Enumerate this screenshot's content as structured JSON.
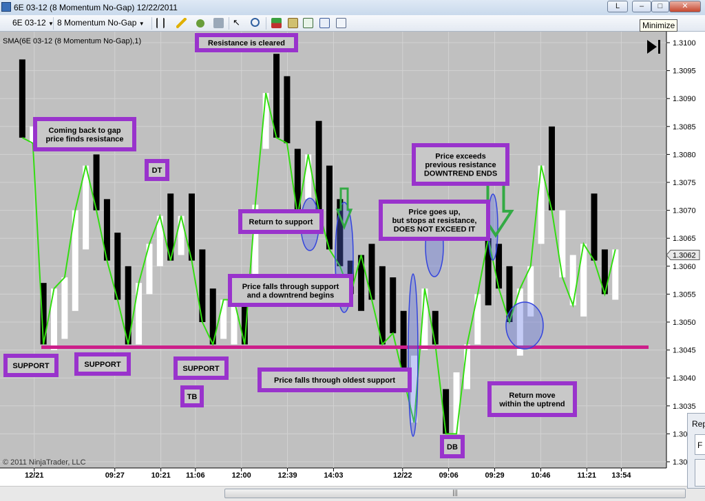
{
  "window": {
    "title": "6E 03-12 (8 Momentum No-Gap)  12/22/2011",
    "buttons": {
      "layout": "L",
      "minimize": "–",
      "restore": "□",
      "close": "✕"
    }
  },
  "toolbar": {
    "instrument": "6E 03-12",
    "period": "8 Momentum No-Gap",
    "tooltip": "Minimize",
    "icons": [
      "bar-style-icon",
      "draw-pencil-icon",
      "add-indicator-icon",
      "strategy-icon",
      "pointer-icon",
      "zoom-icon",
      "orders-icon",
      "trade-data-icon",
      "chart-data-icon",
      "properties-icon"
    ]
  },
  "chart_data": {
    "type": "bar",
    "indicator_label": "SMA(6E 03-12 (8 Momentum No-Gap),1)",
    "copyright": "© 2011 NinjaTrader, LLC",
    "price_marker": "1.3062",
    "ylim": [
      1.3025,
      1.3103
    ],
    "y_ticks": [
      "1.3100",
      "1.3095",
      "1.3090",
      "1.3085",
      "1.3080",
      "1.3075",
      "1.3070",
      "1.3065",
      "1.3060",
      "1.3055",
      "1.3050",
      "1.3045",
      "1.3040",
      "1.3035",
      "1.30",
      "1.30"
    ],
    "x_ticks": [
      {
        "i": 1,
        "label": "12/21"
      },
      {
        "i": 8,
        "label": "09:27"
      },
      {
        "i": 12,
        "label": "10:21"
      },
      {
        "i": 15,
        "label": "11:06"
      },
      {
        "i": 19,
        "label": "12:00"
      },
      {
        "i": 23,
        "label": "12:39"
      },
      {
        "i": 27,
        "label": "14:03"
      },
      {
        "i": 33,
        "label": "12/22"
      },
      {
        "i": 37,
        "label": "09:06"
      },
      {
        "i": 41,
        "label": "09:29"
      },
      {
        "i": 45,
        "label": "10:46"
      },
      {
        "i": 49,
        "label": "11:21"
      },
      {
        "i": 52,
        "label": "13:54"
      }
    ],
    "bars": [
      {
        "i": 0,
        "open": 1.3097,
        "close": 1.3083,
        "color": "black"
      },
      {
        "i": 1,
        "open": 1.3085,
        "close": 1.3082,
        "color": "white"
      },
      {
        "i": 2,
        "open": 1.3057,
        "close": 1.3046,
        "color": "black"
      },
      {
        "i": 3,
        "open": 1.3045,
        "close": 1.3056,
        "color": "white"
      },
      {
        "i": 4,
        "open": 1.3047,
        "close": 1.3058,
        "color": "white"
      },
      {
        "i": 5,
        "open": 1.3052,
        "close": 1.307,
        "color": "white"
      },
      {
        "i": 6,
        "open": 1.3063,
        "close": 1.3078,
        "color": "white"
      },
      {
        "i": 7,
        "open": 1.308,
        "close": 1.307,
        "color": "black"
      },
      {
        "i": 8,
        "open": 1.3072,
        "close": 1.3061,
        "color": "black"
      },
      {
        "i": 9,
        "open": 1.3066,
        "close": 1.3054,
        "color": "black"
      },
      {
        "i": 10,
        "open": 1.306,
        "close": 1.3046,
        "color": "black"
      },
      {
        "i": 11,
        "open": 1.3046,
        "close": 1.3057,
        "color": "white"
      },
      {
        "i": 12,
        "open": 1.3055,
        "close": 1.3064,
        "color": "white"
      },
      {
        "i": 13,
        "open": 1.306,
        "close": 1.3069,
        "color": "white"
      },
      {
        "i": 14,
        "open": 1.3073,
        "close": 1.3061,
        "color": "black"
      },
      {
        "i": 15,
        "open": 1.3062,
        "close": 1.3069,
        "color": "white"
      },
      {
        "i": 16,
        "open": 1.3073,
        "close": 1.3061,
        "color": "black"
      },
      {
        "i": 17,
        "open": 1.3063,
        "close": 1.305,
        "color": "black"
      },
      {
        "i": 18,
        "open": 1.3056,
        "close": 1.3046,
        "color": "black"
      },
      {
        "i": 19,
        "open": 1.3047,
        "close": 1.3054,
        "color": "white"
      },
      {
        "i": 20,
        "open": 1.3046,
        "close": 1.3054,
        "color": "white"
      },
      {
        "i": 21,
        "open": 1.3054,
        "close": 1.3046,
        "color": "black"
      }
    ],
    "sma_line": [],
    "support_level": 1.30455,
    "annotations": [
      {
        "id": "coming-back",
        "text": [
          "Coming back to gap",
          "price finds resistance"
        ]
      },
      {
        "id": "dt",
        "text": [
          "DT"
        ]
      },
      {
        "id": "resistance-cleared",
        "text": [
          "Resistance is cleared"
        ]
      },
      {
        "id": "return-support",
        "text": [
          "Return to support"
        ]
      },
      {
        "id": "price-falls",
        "text": [
          "Price falls through support",
          "and a downtrend begins"
        ]
      },
      {
        "id": "support-1",
        "text": [
          "SUPPORT"
        ]
      },
      {
        "id": "support-2",
        "text": [
          "SUPPORT"
        ]
      },
      {
        "id": "support-3",
        "text": [
          "SUPPORT"
        ]
      },
      {
        "id": "tb",
        "text": [
          "TB"
        ]
      },
      {
        "id": "oldest-support",
        "text": [
          "Price falls through oldest support"
        ]
      },
      {
        "id": "goes-up",
        "text": [
          "Price goes up,",
          "but stops at resistance,",
          "DOES NOT EXCEED IT"
        ]
      },
      {
        "id": "exceeds",
        "text": [
          "Price exceeds",
          "previous resistance",
          "DOWNTREND ENDS"
        ]
      },
      {
        "id": "return-move",
        "text": [
          "Return move",
          "within the uptrend"
        ]
      },
      {
        "id": "db",
        "text": [
          "DB"
        ]
      }
    ],
    "colors": {
      "background": "#c0c0c0",
      "up_bar": "#ffffff",
      "down_bar": "#000000",
      "sma": "#33dd11",
      "support_line": "#cc1f8a",
      "annotation_border": "#9933cc",
      "ellipse": "#3344dd",
      "arrow": "#33aa44"
    }
  },
  "scrollbar": {
    "thumb_grip": "|||"
  },
  "side_window": {
    "title": "Rep",
    "field": "F"
  }
}
